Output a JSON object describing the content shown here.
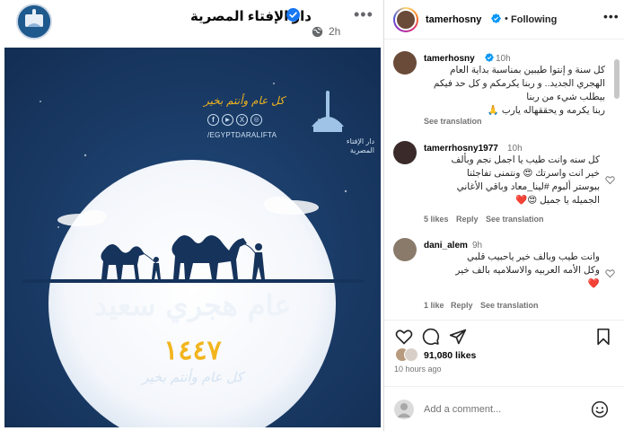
{
  "fb_post": {
    "page_name": "دار الإفتاء المصرية",
    "time": "2h",
    "image": {
      "logo_text": "دار الإفتاء المصرية",
      "calligraphy_top": "كل عام وأنتم بخير",
      "handle": "/EGYPTDARALIFTA",
      "social_icons": [
        "facebook-icon",
        "youtube-icon",
        "x-icon",
        "instagram-icon"
      ],
      "greeting": "عام هجري سعيد",
      "year": "١٤٤٧",
      "calligraphy_bottom": "كل عام وأنتم بخير"
    }
  },
  "ig": {
    "username": "tamerhosny",
    "following_label": "Following",
    "dot": "•",
    "comments": [
      {
        "user": "tamerhosny",
        "verified": true,
        "time": "10h",
        "lines": [
          "كل سنة و إنتوا طيبين بمناسبة بداية العام",
          "الهجري الجديد.. و ربنا يكرمكم و كل حد فيكم",
          "بيطلب شيء من ربنا",
          "ربنا يكرمه و يحققهاله يارب 🙏"
        ],
        "see_translation": "See translation"
      },
      {
        "user": "tamerrhosny1977",
        "time": "10h",
        "lines": [
          "كل سنه وانت طيب يا اجمل نجم وبألف",
          "خير انت واسرتك 😍 ونتمنى تفاجئنا",
          "ببوستر ألبوم #لينا_معاد وباقي الأغاني",
          "الجميله يا جميل 😍❤️"
        ],
        "likes": "5 likes",
        "reply": "Reply",
        "see_translation": "See translation"
      },
      {
        "user": "dani_alem",
        "time": "9h",
        "lines": [
          "وانت طيب وبالف خير ياحبيب قلبي",
          "وكل الأمه العربيه والاسلاميه بالف خير",
          "❤️"
        ],
        "likes": "1 like",
        "reply": "Reply",
        "see_translation": "See translation"
      }
    ],
    "likes_count": "91,080 likes",
    "time_ago": "10 hours ago",
    "add_comment_placeholder": "Add a comment..."
  },
  "colors": {
    "ig_blue": "#0095f6",
    "verified_blue": "#0095f6",
    "fb_verified": "#1877f2",
    "image_bg": "#193a66",
    "gold": "#f2b51e"
  }
}
